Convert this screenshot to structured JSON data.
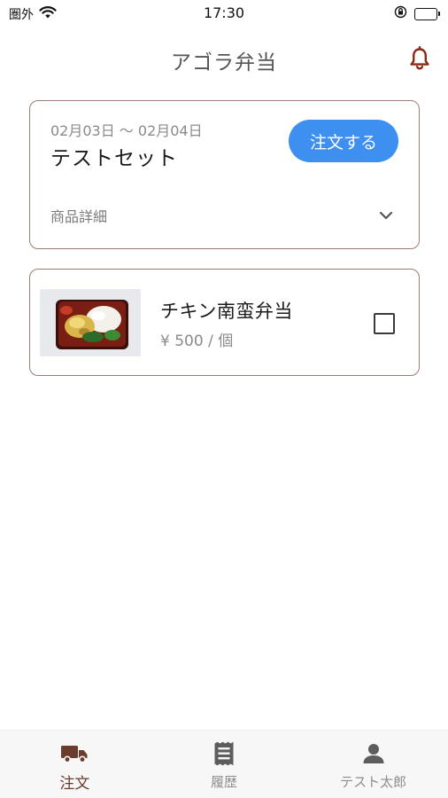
{
  "status_bar": {
    "carrier": "圏外",
    "time": "17:30",
    "icons": [
      "wifi-icon",
      "orientation-lock-icon",
      "battery-charging-icon"
    ],
    "battery_color": "#2fbf3a"
  },
  "header": {
    "title": "アゴラ弁当",
    "notification_icon": "bell-icon",
    "accent_color": "#8b2a12"
  },
  "order_set": {
    "date_range": "02月03日 〜 02月04日",
    "name": "テストセット",
    "order_button_label": "注文する",
    "order_button_color": "#3d8ff0",
    "details_label": "商品詳細",
    "expand_icon": "chevron-down-icon"
  },
  "items": [
    {
      "name": "チキン南蛮弁当",
      "price": "¥ 500 / 個",
      "image": "bento-photo",
      "checked": false
    }
  ],
  "bottom_nav": {
    "active_color": "#6b3b2b",
    "items": [
      {
        "label": "注文",
        "icon": "truck-icon",
        "active": true
      },
      {
        "label": "履歴",
        "icon": "receipt-icon",
        "active": false
      },
      {
        "label": "テスト太郎",
        "icon": "person-icon",
        "active": false
      }
    ]
  }
}
